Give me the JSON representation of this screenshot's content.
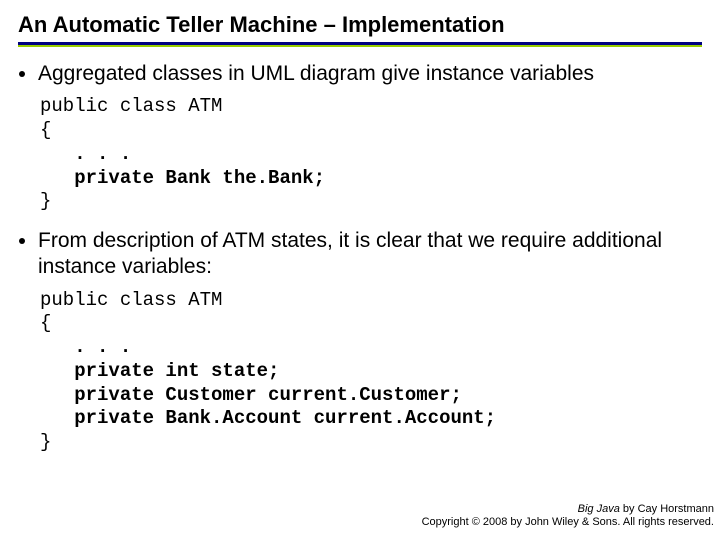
{
  "title": "An Automatic Teller Machine – Implementation",
  "bullets": {
    "b1": "Aggregated classes in UML diagram give instance variables",
    "b2": "From description of ATM states, it is clear that we require additional instance variables:"
  },
  "code1": {
    "l1": "public class ATM",
    "l2": "{",
    "l3": "   . . .",
    "l4": "   private Bank the.Bank;",
    "l5": "}"
  },
  "code2": {
    "l1": "public class ATM",
    "l2": "{",
    "l3": "   . . .",
    "l4": "   private int state;",
    "l5": "   private Customer current.Customer;",
    "l6": "   private Bank.Account current.Account;",
    "l7": "}"
  },
  "footer": {
    "line1a": "Big Java",
    "line1b": " by Cay Horstmann",
    "line2": "Copyright © 2008 by John Wiley & Sons. All rights reserved."
  }
}
